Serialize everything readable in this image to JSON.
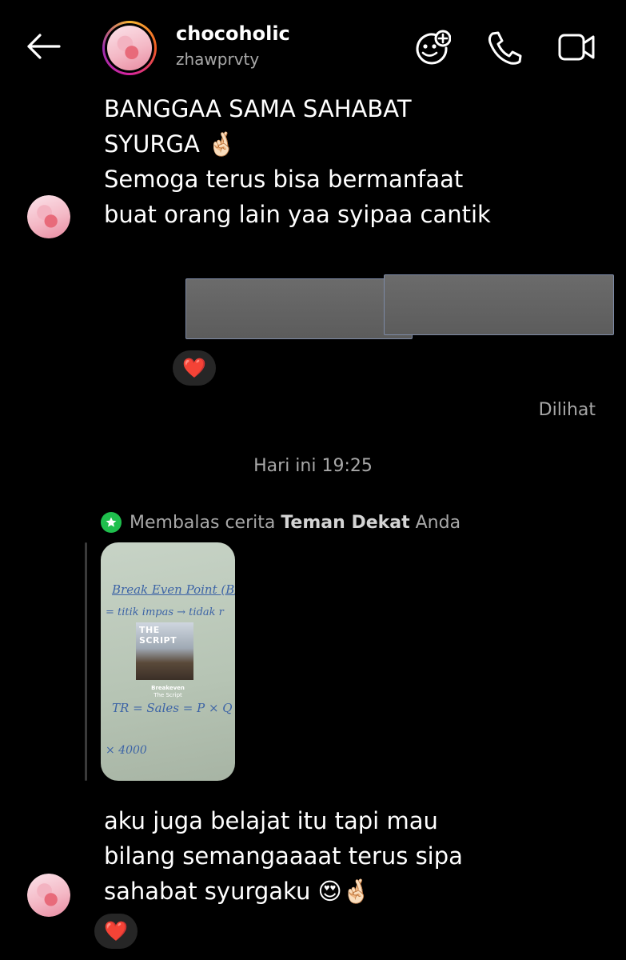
{
  "header": {
    "name": "chocoholic",
    "username": "zhawprvty"
  },
  "messages": {
    "first_lines": [
      "BANGGAA SAMA SAHABAT",
      "SYURGA 🤞🏻",
      "Semoga terus bisa bermanfaat",
      "buat orang lain yaa syipaa cantik"
    ],
    "reaction_1": "❤️",
    "seen_label": "Dilihat",
    "timestamp": "Hari ini 19:25",
    "reply_prefix": "Membalas cerita",
    "reply_bold": "Teman Dekat",
    "reply_suffix": "Anda",
    "story": {
      "board_lines": [
        "Break Even Point (BEP)",
        "= titik impas  →  tidak r",
        "TR = Sales = P × Q",
        "× 4000"
      ],
      "album_title": "THE SCRIPT",
      "song_title": "Breakeven",
      "song_artist": "The Script"
    },
    "last_lines": [
      "aku juga belajat itu tapi mau",
      "bilang semangaaaat terus sipa",
      "sahabat syurgaku 😍🤞🏻"
    ],
    "reaction_2": "❤️"
  },
  "colors": {
    "background": "#000000",
    "secondary_text": "#a8a8a8",
    "close_friends_green": "#1fbf4d",
    "reaction_bg": "#262626"
  },
  "icons": [
    "back-arrow-icon",
    "sticker-add-icon",
    "phone-icon",
    "video-camera-icon",
    "star-icon"
  ]
}
